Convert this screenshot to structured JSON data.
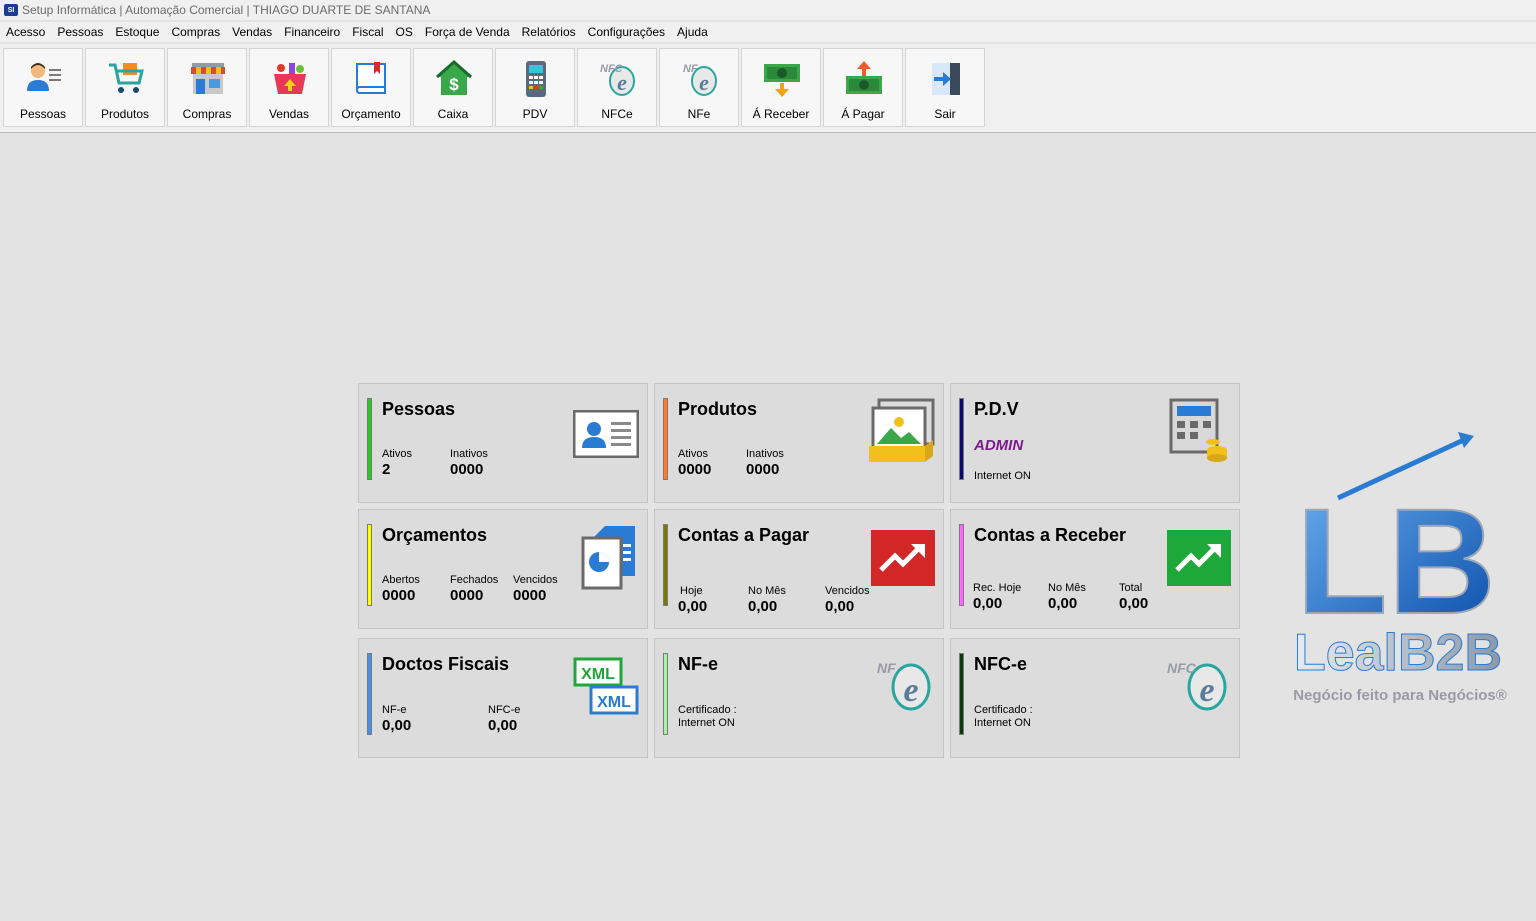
{
  "window": {
    "app_icon_text": "SI",
    "title": "Setup Informática | Automação Comercial | THIAGO DUARTE DE SANTANA"
  },
  "menu": [
    "Acesso",
    "Pessoas",
    "Estoque",
    "Compras",
    "Vendas",
    "Financeiro",
    "Fiscal",
    "OS",
    "Força de Venda",
    "Relatórios",
    "Configurações",
    "Ajuda"
  ],
  "toolbar": [
    {
      "label": "Pessoas",
      "icon": "person-card-icon"
    },
    {
      "label": "Produtos",
      "icon": "shopping-cart-icon"
    },
    {
      "label": "Compras",
      "icon": "storefront-icon"
    },
    {
      "label": "Vendas",
      "icon": "shopping-basket-icon"
    },
    {
      "label": "Orçamento",
      "icon": "book-icon"
    },
    {
      "label": "Caixa",
      "icon": "cash-house-icon"
    },
    {
      "label": "PDV",
      "icon": "card-terminal-icon"
    },
    {
      "label": "NFCe",
      "icon": "nfce-icon",
      "icon_text": "NFC"
    },
    {
      "label": "NFe",
      "icon": "nfe-icon",
      "icon_text": "NF"
    },
    {
      "label": "Á Receber",
      "icon": "money-down-icon"
    },
    {
      "label": "Á Pagar",
      "icon": "money-up-icon"
    },
    {
      "label": "Sair",
      "icon": "exit-icon"
    }
  ],
  "cards": {
    "pessoas": {
      "title": "Pessoas",
      "color": "#22cc22",
      "ativos_label": "Ativos",
      "ativos": "2",
      "inativos_label": "Inativos",
      "inativos": "0000"
    },
    "produtos": {
      "title": "Produtos",
      "color": "#ff7a2a",
      "ativos_label": "Ativos",
      "ativos": "0000",
      "inativos_label": "Inativos",
      "inativos": "0000"
    },
    "pdv": {
      "title": "P.D.V",
      "color": "#0a0a6e",
      "user": "ADMIN",
      "user_color": "#7a1a8c",
      "status": "Internet ON"
    },
    "orcamentos": {
      "title": "Orçamentos",
      "color": "#ffff00",
      "abertos_label": "Abertos",
      "abertos": "0000",
      "fechados_label": "Fechados",
      "fechados": "0000",
      "vencidos_label": "Vencidos",
      "vencidos": "0000"
    },
    "contas_pagar": {
      "title": "Contas a Pagar",
      "color": "#7a7a00",
      "hoje_label": "Hoje",
      "hoje": "0,00",
      "mes_label": "No Mês",
      "mes": "0,00",
      "vencidos_label": "Vencidos",
      "vencidos": "0,00"
    },
    "contas_receber": {
      "title": "Contas a Receber",
      "color": "#ff66ff",
      "hoje_label": "Rec. Hoje",
      "hoje": "0,00",
      "mes_label": "No Mês",
      "mes": "0,00",
      "total_label": "Total",
      "total": "0,00"
    },
    "doctos": {
      "title": "Doctos Fiscais",
      "color": "#4a90e2",
      "nfe_label": "NF-e",
      "nfe": "0,00",
      "nfce_label": "NFC-e",
      "nfce": "0,00",
      "xml_text": "XML"
    },
    "nfe": {
      "title": "NF-e",
      "color": "#a8f0a8",
      "cert_label": "Certificado :",
      "status": "Internet ON",
      "icon_text": "NF"
    },
    "nfce": {
      "title": "NFC-e",
      "color": "#0a3a0a",
      "cert_label": "Certificado :",
      "status": "Internet ON",
      "icon_text": "NFC"
    }
  },
  "logo": {
    "letters": "LB",
    "brand": "LealB2B",
    "tagline": "Negócio feito para Negócios®"
  },
  "colors": {
    "red_tile": "#d32626",
    "green_tile": "#1ea83a",
    "blue_icon": "#2a7bd4"
  }
}
